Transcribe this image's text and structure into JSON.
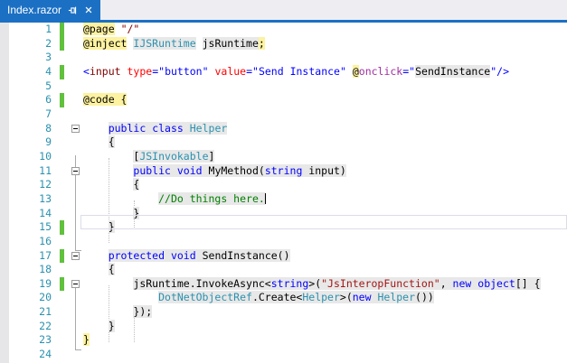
{
  "tab": {
    "title": "Index.razor",
    "pin_icon": "pin-icon",
    "close_icon": "close-icon"
  },
  "colors": {
    "tab_blue": "#1B70C4",
    "razor_yellow": "#FDF2A0",
    "csharp_background": "#E8E8E8",
    "keyword_blue": "#0000FF",
    "type_teal": "#2B91AF",
    "string_maroon": "#A31515",
    "comment_green": "#008000",
    "html_tag_maroon": "#800000",
    "html_attr_red": "#FF0000",
    "razor_attr_purple": "#A02DA2",
    "line_number_teal": "#2B91AF",
    "change_bar_green": "#60C13D"
  },
  "editor": {
    "caret_line": 13,
    "current_line": 13,
    "changed_lines": [
      1,
      2,
      4,
      6,
      15,
      17,
      19
    ],
    "fold_lines": [
      8,
      11,
      17,
      19
    ],
    "lines": [
      {
        "n": 1,
        "chg": true,
        "segs": [
          [
            "@page",
            "y"
          ],
          [
            " ",
            "w"
          ],
          [
            "\"/\"",
            "mw"
          ]
        ]
      },
      {
        "n": 2,
        "chg": true,
        "segs": [
          [
            "@inject",
            "y"
          ],
          [
            " ",
            "w"
          ],
          [
            "IJSRuntime",
            "tg"
          ],
          [
            " ",
            "w"
          ],
          [
            "jsRuntime",
            "pg"
          ],
          [
            ";",
            "y"
          ]
        ]
      },
      {
        "n": 3,
        "segs": []
      },
      {
        "n": 4,
        "chg": true,
        "segs": [
          [
            "<",
            "kw"
          ],
          [
            "input",
            "mw"
          ],
          [
            " ",
            "w"
          ],
          [
            "type",
            "rw"
          ],
          [
            "=",
            "kw"
          ],
          [
            "\"button\"",
            "kw"
          ],
          [
            " ",
            "w"
          ],
          [
            "value",
            "rw"
          ],
          [
            "=",
            "kw"
          ],
          [
            "\"Send Instance\"",
            "kw"
          ],
          [
            " ",
            "w"
          ],
          [
            "@",
            "y"
          ],
          [
            "onclick",
            "uw"
          ],
          [
            "=",
            "kw"
          ],
          [
            "\"",
            "kw"
          ],
          [
            "SendInstance",
            "pg"
          ],
          [
            "\"",
            "kw"
          ],
          [
            "/>",
            "kw"
          ]
        ]
      },
      {
        "n": 5,
        "segs": []
      },
      {
        "n": 6,
        "chg": true,
        "segs": [
          [
            "@code {",
            "y"
          ]
        ]
      },
      {
        "n": 7,
        "segs": []
      },
      {
        "n": 8,
        "fold": true,
        "segs": [
          [
            "    ",
            "w"
          ],
          [
            "public",
            "kg"
          ],
          [
            " ",
            "pg"
          ],
          [
            "class",
            "kg"
          ],
          [
            " ",
            "pg"
          ],
          [
            "Helper",
            "tg"
          ]
        ]
      },
      {
        "n": 9,
        "segs": [
          [
            "    ",
            "w"
          ],
          [
            "{",
            "pg"
          ]
        ]
      },
      {
        "n": 10,
        "segs": [
          [
            "        ",
            "w"
          ],
          [
            "[",
            "pg"
          ],
          [
            "JSInvokable",
            "tg"
          ],
          [
            "]",
            "pg"
          ]
        ]
      },
      {
        "n": 11,
        "fold": true,
        "segs": [
          [
            "        ",
            "w"
          ],
          [
            "public",
            "kg"
          ],
          [
            " ",
            "pg"
          ],
          [
            "void",
            "kg"
          ],
          [
            " ",
            "pg"
          ],
          [
            "MyMethod(",
            "pg"
          ],
          [
            "string",
            "kg"
          ],
          [
            " input)",
            "pg"
          ]
        ]
      },
      {
        "n": 12,
        "segs": [
          [
            "        ",
            "w"
          ],
          [
            "{",
            "pg"
          ]
        ]
      },
      {
        "n": 13,
        "caret": true,
        "segs": [
          [
            "            ",
            "w"
          ],
          [
            "//Do things here.",
            "cg"
          ]
        ]
      },
      {
        "n": 14,
        "segs": [
          [
            "        ",
            "w"
          ],
          [
            "}",
            "pg"
          ]
        ]
      },
      {
        "n": 15,
        "chg": true,
        "segs": [
          [
            "    ",
            "w"
          ],
          [
            "}",
            "pg"
          ]
        ]
      },
      {
        "n": 16,
        "segs": []
      },
      {
        "n": 17,
        "chg": true,
        "fold": true,
        "segs": [
          [
            "    ",
            "w"
          ],
          [
            "protected",
            "kg"
          ],
          [
            " ",
            "pg"
          ],
          [
            "void",
            "kg"
          ],
          [
            " ",
            "pg"
          ],
          [
            "SendInstance()",
            "pg"
          ]
        ]
      },
      {
        "n": 18,
        "segs": [
          [
            "    ",
            "w"
          ],
          [
            "{",
            "pg"
          ]
        ]
      },
      {
        "n": 19,
        "chg": true,
        "fold": true,
        "segs": [
          [
            "        ",
            "w"
          ],
          [
            "jsRuntime.InvokeAsync<",
            "pg"
          ],
          [
            "string",
            "kg"
          ],
          [
            ">(",
            "pg"
          ],
          [
            "\"JsInteropFunction\"",
            "sg"
          ],
          [
            ", ",
            "pg"
          ],
          [
            "new",
            "kg"
          ],
          [
            " ",
            "pg"
          ],
          [
            "object",
            "kg"
          ],
          [
            "[] {",
            "pg"
          ]
        ]
      },
      {
        "n": 20,
        "segs": [
          [
            "            ",
            "w"
          ],
          [
            "DotNetObjectRef",
            "tg"
          ],
          [
            ".Create<",
            "pg"
          ],
          [
            "Helper",
            "tg"
          ],
          [
            ">(",
            "pg"
          ],
          [
            "new",
            "kg"
          ],
          [
            " ",
            "pg"
          ],
          [
            "Helper",
            "tg"
          ],
          [
            "())",
            "pg"
          ]
        ]
      },
      {
        "n": 21,
        "segs": [
          [
            "        ",
            "w"
          ],
          [
            "});",
            "pg"
          ]
        ]
      },
      {
        "n": 22,
        "segs": [
          [
            "    ",
            "w"
          ],
          [
            "}",
            "pg"
          ]
        ]
      },
      {
        "n": 23,
        "segs": [
          [
            "}",
            "y"
          ]
        ]
      },
      {
        "n": 24,
        "segs": []
      }
    ]
  }
}
